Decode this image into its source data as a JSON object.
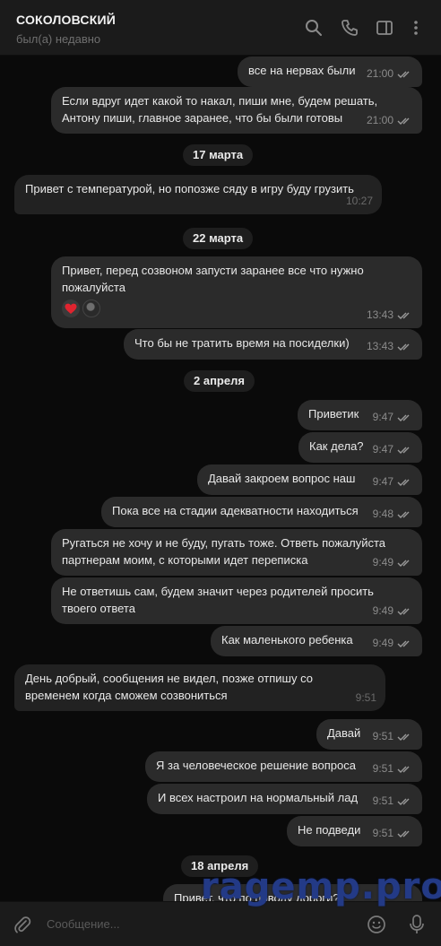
{
  "header": {
    "title": "СОКОЛОВСКИЙ",
    "status": "был(а) недавно",
    "icons": [
      "search-icon",
      "phone-icon",
      "sidebar-icon",
      "more-icon"
    ]
  },
  "messages": [
    {
      "text": "все на нервах были",
      "time": "21:00",
      "dir": "out"
    },
    {
      "text": "Если вдруг идет какой то накал, пиши мне, будем решать,\nАнтону пиши, главное заранее, что бы были готовы",
      "time": "21:00",
      "dir": "out"
    },
    {
      "date": "17 марта"
    },
    {
      "text": "Привет с температурой, но попозже сяду в игру буду грузить",
      "time": "10:27",
      "dir": "in"
    },
    {
      "date": "22 марта"
    },
    {
      "text": "Привет, перед созвоном запусти заранее все что нужно\nпожалуйста",
      "time": "13:43",
      "dir": "out",
      "reactions": [
        "heart-reaction",
        "avatar"
      ]
    },
    {
      "text": "Что бы не тратить время на посиделки)",
      "time": "13:43",
      "dir": "out"
    },
    {
      "date": "2 апреля"
    },
    {
      "text": "Приветик",
      "time": "9:47",
      "dir": "out"
    },
    {
      "text": "Как дела?",
      "time": "9:47",
      "dir": "out"
    },
    {
      "text": "Давай закроем вопрос наш",
      "time": "9:47",
      "dir": "out"
    },
    {
      "text": "Пока все на стадии адекватности находиться",
      "time": "9:48",
      "dir": "out"
    },
    {
      "text": "Ругаться не хочу и не буду, пугать тоже. Ответь пожалуйста\nпартнерам моим, с которыми идет переписка",
      "time": "9:49",
      "dir": "out"
    },
    {
      "text": "Не ответишь сам, будем значит через родителей просить\nтвоего ответа",
      "time": "9:49",
      "dir": "out"
    },
    {
      "text": "Как маленького ребенка",
      "time": "9:49",
      "dir": "out"
    },
    {
      "text": "День добрый, сообщения не видел, позже отпишу со\nвременем когда сможем созвониться",
      "time": "9:51",
      "dir": "in"
    },
    {
      "text": "Давай",
      "time": "9:51",
      "dir": "out"
    },
    {
      "text": "Я за человеческое решение вопроса",
      "time": "9:51",
      "dir": "out"
    },
    {
      "text": "И всех настроил на нормальный лад",
      "time": "9:51",
      "dir": "out"
    },
    {
      "text": "Не подведи",
      "time": "9:51",
      "dir": "out"
    },
    {
      "date": "18 апреля"
    },
    {
      "text": "Привет, что по поводу дороги?",
      "time": "",
      "dir": "out"
    }
  ],
  "composer": {
    "placeholder": "Сообщение...",
    "icons": [
      "attach-icon",
      "emoji-icon",
      "mic-icon"
    ]
  },
  "watermark": "ragemp.pro",
  "colors": {
    "background": "#0a0a0a",
    "bubble": "#2b2b2b",
    "header": "#1b1b1b",
    "watermark": "#233a86",
    "heart": "#e0242f"
  }
}
